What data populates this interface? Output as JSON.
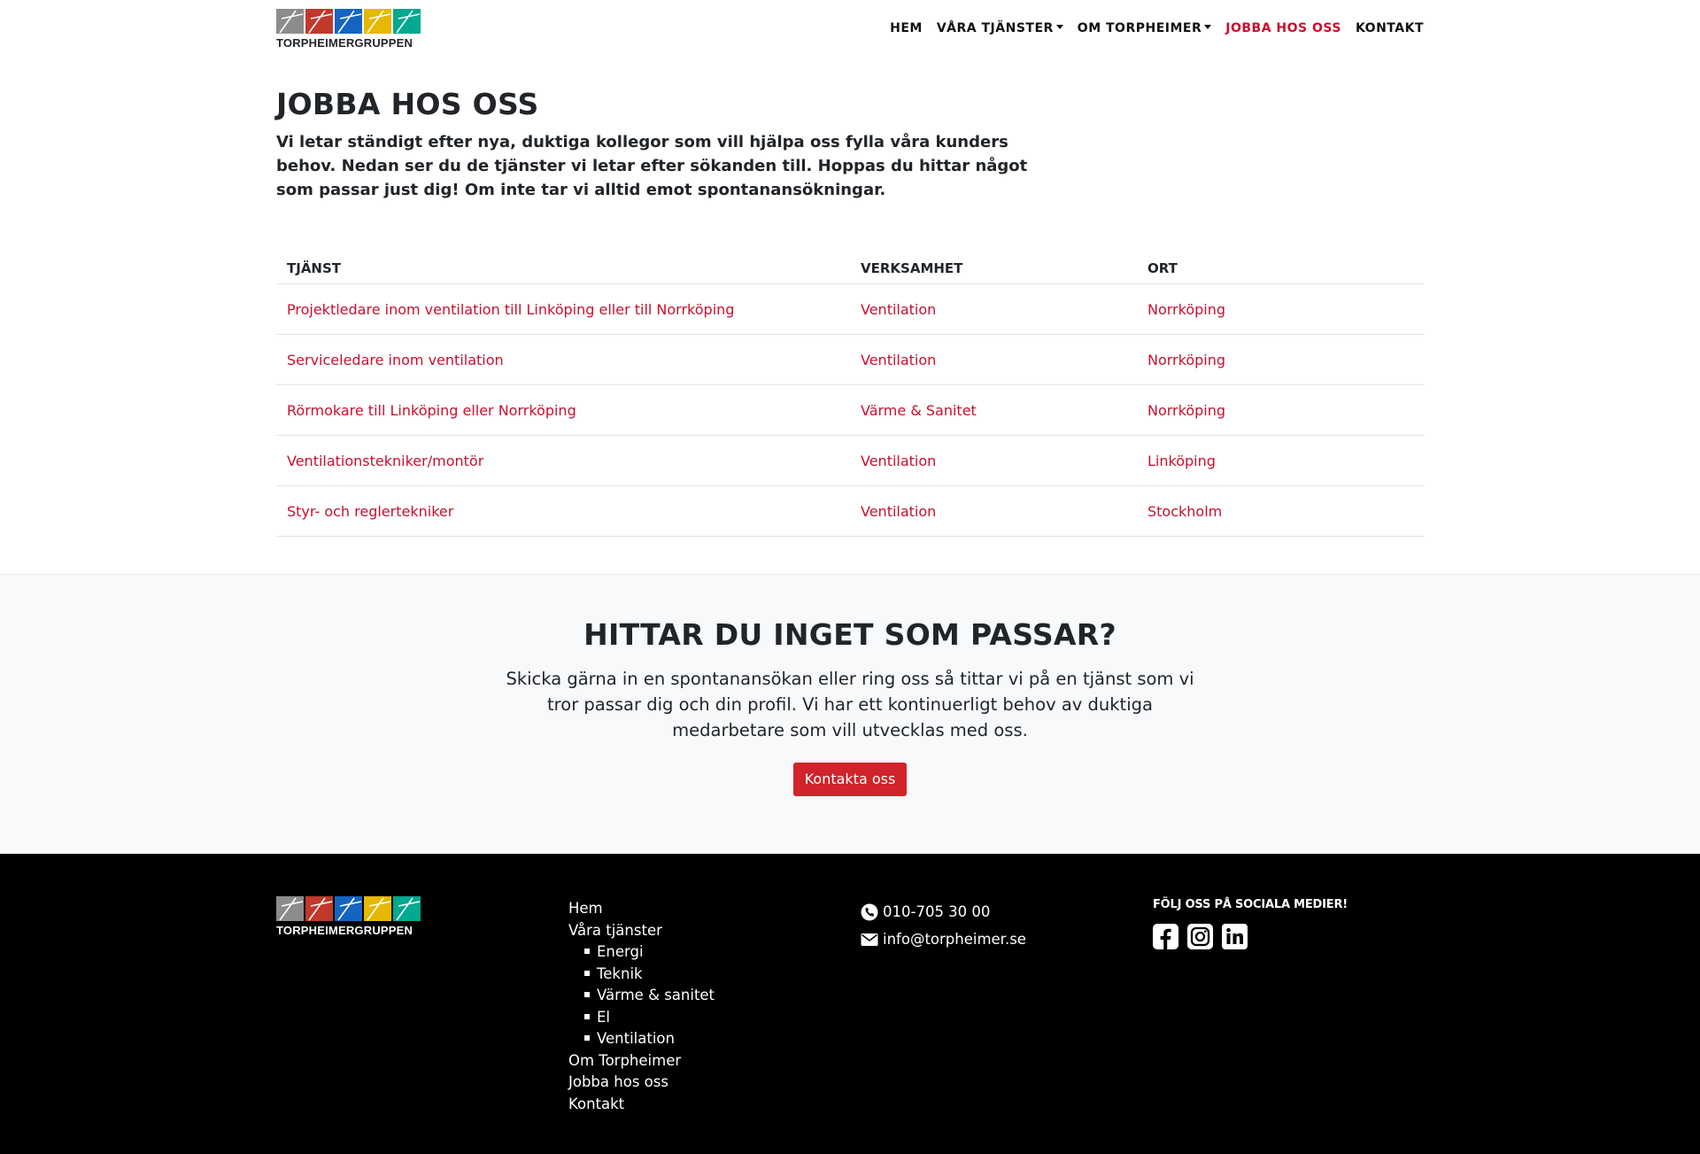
{
  "brand": {
    "name": "TORPHEIMERGRUPPEN",
    "tile_colors": [
      "#8c8c8c",
      "#c0392b",
      "#1565c0",
      "#e6b800",
      "#00a98f"
    ]
  },
  "nav": {
    "items": [
      {
        "label": "HEM",
        "dropdown": false,
        "active": false
      },
      {
        "label": "VÅRA TJÄNSTER",
        "dropdown": true,
        "active": false
      },
      {
        "label": "OM TORPHEIMER",
        "dropdown": true,
        "active": false
      },
      {
        "label": "JOBBA HOS OSS",
        "dropdown": false,
        "active": true
      },
      {
        "label": "KONTAKT",
        "dropdown": false,
        "active": false
      }
    ]
  },
  "intro": {
    "title": "JOBBA HOS OSS",
    "text": "Vi letar ständigt efter nya, duktiga kollegor som vill hjälpa oss fylla våra kunders behov. Nedan ser du de tjänster vi letar efter sökanden till. Hoppas du hittar något som passar just dig! Om inte tar vi alltid emot spontanansökningar."
  },
  "jobs": {
    "headers": [
      "TJÄNST",
      "VERKSAMHET",
      "ORT"
    ],
    "rows": [
      [
        "Projektledare inom ventilation till Linköping eller till Norrköping",
        "Ventilation",
        "Norrköping"
      ],
      [
        "Serviceledare inom ventilation",
        "Ventilation",
        "Norrköping"
      ],
      [
        "Rörmokare till Linköping eller Norrköping",
        "Värme & Sanitet",
        "Norrköping"
      ],
      [
        "Ventilationstekniker/montör",
        "Ventilation",
        "Linköping"
      ],
      [
        "Styr- och reglertekniker",
        "Ventilation",
        "Stockholm"
      ]
    ]
  },
  "cta": {
    "title": "HITTAR DU INGET SOM PASSAR?",
    "text": "Skicka gärna in en spontanansökan eller ring oss så tittar vi på en tjänst som vi tror passar dig och din profil. Vi har ett kontinuerligt behov av duktiga medarbetare som vill utvecklas med oss.",
    "button": "Kontakta oss"
  },
  "footer": {
    "menu": {
      "hem": "Hem",
      "tjanster": "Våra tjänster",
      "sub": [
        "Energi",
        "Teknik",
        "Värme & sanitet",
        "El",
        "Ventilation"
      ],
      "om": "Om Torpheimer",
      "jobba": "Jobba hos oss",
      "kontakt": "Kontakt"
    },
    "phone": "010-705 30 00",
    "email": "info@torpheimer.se",
    "social_title": "FÖLJ OSS PÅ SOCIALA MEDIER!",
    "social_icons": [
      "facebook-icon",
      "instagram-icon",
      "linkedin-icon"
    ]
  },
  "colors": {
    "accent": "#c8102e",
    "button": "#d0232a",
    "footer_bg": "#000000",
    "cta_bg": "#f8f9fa"
  }
}
